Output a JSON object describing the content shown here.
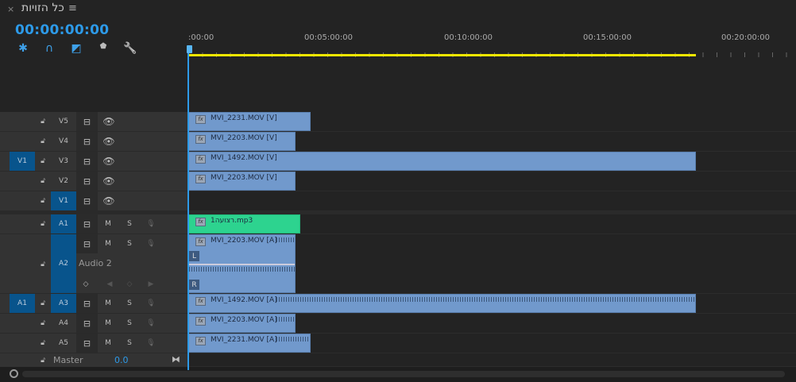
{
  "tab": {
    "title": "כל הזויות",
    "close": "×",
    "menu": "≡"
  },
  "timecode": "00:00:00:00",
  "toolbar": [
    {
      "icon": "snap-icon",
      "glyph": "✱"
    },
    {
      "icon": "magnet-icon",
      "glyph": "∩"
    },
    {
      "icon": "linked-selection-icon",
      "glyph": "◩"
    },
    {
      "icon": "add-marker-icon",
      "glyph": "⬟"
    },
    {
      "icon": "wrench-icon",
      "glyph": "🔧"
    }
  ],
  "ruler": {
    "labels": [
      ":00:00",
      "00:05:00:00",
      "00:10:00:00",
      "00:15:00:00",
      "00:20:00:00"
    ],
    "work_area_end_seconds": 1095
  },
  "video_tracks": [
    {
      "label": "V5",
      "source": "",
      "targeted": false
    },
    {
      "label": "V4",
      "source": "",
      "targeted": false
    },
    {
      "label": "V3",
      "source": "V1",
      "targeted": false
    },
    {
      "label": "V2",
      "source": "",
      "targeted": false
    },
    {
      "label": "V1",
      "source": "",
      "targeted": true
    }
  ],
  "audio_tracks": [
    {
      "label": "A1",
      "source": "",
      "targeted": true,
      "m": "M",
      "s": "S"
    },
    {
      "label": "A2",
      "source": "",
      "targeted": true,
      "m": "M",
      "s": "S",
      "name": "Audio 2"
    },
    {
      "label": "A3",
      "source": "A1",
      "targeted": true,
      "m": "M",
      "s": "S"
    },
    {
      "label": "A4",
      "source": "",
      "targeted": false,
      "m": "M",
      "s": "S"
    },
    {
      "label": "A5",
      "source": "",
      "targeted": false,
      "m": "M",
      "s": "S"
    }
  ],
  "master": {
    "label": "Master",
    "value": "0.0"
  },
  "clips": {
    "v5": {
      "name": "MVI_2231.MOV [V]",
      "duration_s": 264
    },
    "v4": {
      "name": "MVI_2203.MOV [V]",
      "duration_s": 231
    },
    "v3": {
      "name": "MVI_1492.MOV [V]",
      "duration_s": 1095
    },
    "v2": {
      "name": "MVI_2203.MOV [V]",
      "duration_s": 231
    },
    "a1": {
      "name": "רצועה1.mp3",
      "duration_s": 242
    },
    "a2": {
      "name": "MVI_2203.MOV [A]",
      "duration_s": 231,
      "left": "L",
      "right": "R"
    },
    "a3": {
      "name": "MVI_1492.MOV [A]",
      "duration_s": 1095
    },
    "a4": {
      "name": "MVI_2203.MOV [A]",
      "duration_s": 231
    },
    "a5": {
      "name": "MVI_2231.MOV [A]",
      "duration_s": 264
    }
  },
  "fx": "fx",
  "colors": {
    "accent": "#2d9ae8",
    "video_clip": "#7199cc",
    "audio_music": "#2dd38f",
    "work_area": "#f2e600",
    "target": "#08548c"
  }
}
